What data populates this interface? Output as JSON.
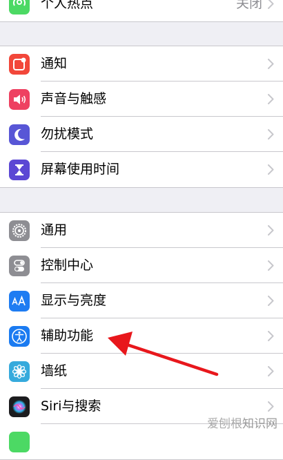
{
  "top_item": {
    "label": "个人热点",
    "value": "关闭",
    "icon": "hotspot-icon"
  },
  "group1": [
    {
      "label": "通知",
      "icon": "notifications-icon",
      "color": "#f2473a"
    },
    {
      "label": "声音与触感",
      "icon": "speaker-icon",
      "color": "#ee4161"
    },
    {
      "label": "勿扰模式",
      "icon": "moon-icon",
      "color": "#5856d6"
    },
    {
      "label": "屏幕使用时间",
      "icon": "hourglass-icon",
      "color": "#5b47d4"
    }
  ],
  "group2": [
    {
      "label": "通用",
      "icon": "gear-icon",
      "color": "#8e8e93"
    },
    {
      "label": "控制中心",
      "icon": "toggles-icon",
      "color": "#8e8e93"
    },
    {
      "label": "显示与亮度",
      "icon": "text-size-icon",
      "color": "#1e7cf2"
    },
    {
      "label": "辅助功能",
      "icon": "accessibility-icon",
      "color": "#1b7bf1"
    },
    {
      "label": "墙纸",
      "icon": "flower-icon",
      "color": "#36aadc"
    },
    {
      "label": "Siri与搜索",
      "icon": "siri-icon",
      "color": "#222222"
    }
  ],
  "watermark": {
    "brand": "爱刨根",
    "text": "知识网"
  },
  "annotation": {
    "type": "red-arrow",
    "target": "辅助功能"
  }
}
